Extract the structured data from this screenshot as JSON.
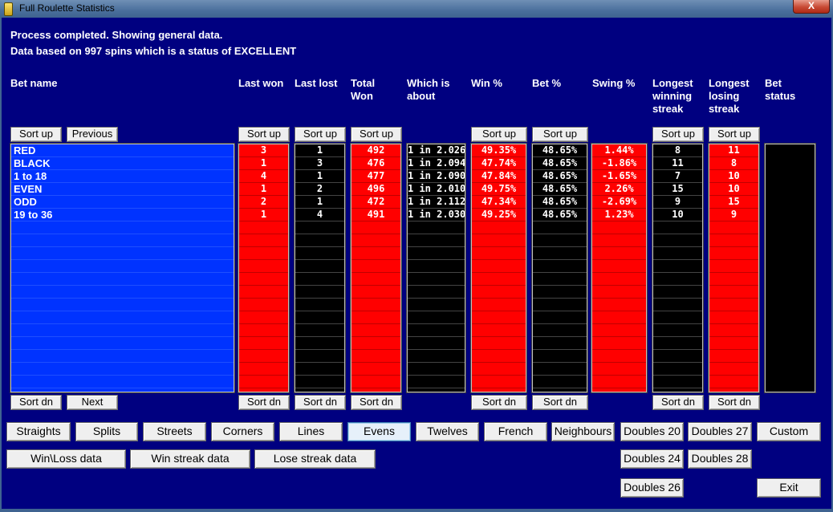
{
  "window": {
    "title": "Full Roulette Statistics",
    "close_label": "X"
  },
  "status": {
    "line1": "Process completed. Showing general data.",
    "line2": "Data based on 997 spins which is a status of EXCELLENT"
  },
  "headers": {
    "bet_name": "Bet name",
    "last_won": "Last won",
    "last_lost": "Last lost",
    "total_won": "Total\nWon",
    "which_is_about": "Which is\nabout",
    "win_pct": "Win %",
    "bet_pct": "Bet %",
    "swing_pct": "Swing %",
    "longest_winning": "Longest\nwinning\nstreak",
    "longest_losing": "Longest\nlosing\nstreak",
    "bet_status": "Bet\nstatus"
  },
  "sort_up_label": "Sort up",
  "sort_dn_label": "Sort dn",
  "previous_label": "Previous",
  "next_label": "Next",
  "columns": {
    "bet_name": [
      "RED",
      "BLACK",
      "1 to 18",
      "EVEN",
      "ODD",
      "19 to 36"
    ],
    "last_won": [
      "3",
      "1",
      "4",
      "1",
      "2",
      "1"
    ],
    "last_lost": [
      "1",
      "3",
      "1",
      "2",
      "1",
      "4"
    ],
    "total_won": [
      "492",
      "476",
      "477",
      "496",
      "472",
      "491"
    ],
    "which_is_about": [
      "1 in 2.026",
      "1 in 2.094",
      "1 in 2.090",
      "1 in 2.010",
      "1 in 2.112",
      "1 in 2.030"
    ],
    "win_pct": [
      "49.35%",
      "47.74%",
      "47.84%",
      "49.75%",
      "47.34%",
      "49.25%"
    ],
    "bet_pct": [
      "48.65%",
      "48.65%",
      "48.65%",
      "48.65%",
      "48.65%",
      "48.65%"
    ],
    "swing_pct": [
      "1.44%",
      "-1.86%",
      "-1.65%",
      "2.26%",
      "-2.69%",
      "1.23%"
    ],
    "longest_winning": [
      "8",
      "11",
      "7",
      "15",
      "9",
      "10"
    ],
    "longest_losing": [
      "11",
      "8",
      "10",
      "10",
      "15",
      "9"
    ]
  },
  "bet_type_buttons": [
    "Straights",
    "Splits",
    "Streets",
    "Corners",
    "Lines",
    "Evens",
    "Twelves",
    "French",
    "Neighbours",
    "Doubles 20",
    "Doubles 27",
    "Custom"
  ],
  "selected_bet_type": "Evens",
  "data_buttons": [
    "Win\\Loss data",
    "Win streak data",
    "Lose streak data"
  ],
  "doubles_extra": [
    "Doubles 24",
    "Doubles 28",
    "Doubles 26"
  ],
  "exit_label": "Exit",
  "colors": {
    "panel": "#000080",
    "red": "#ff0000",
    "blue": "#0033ff",
    "black": "#000000"
  }
}
